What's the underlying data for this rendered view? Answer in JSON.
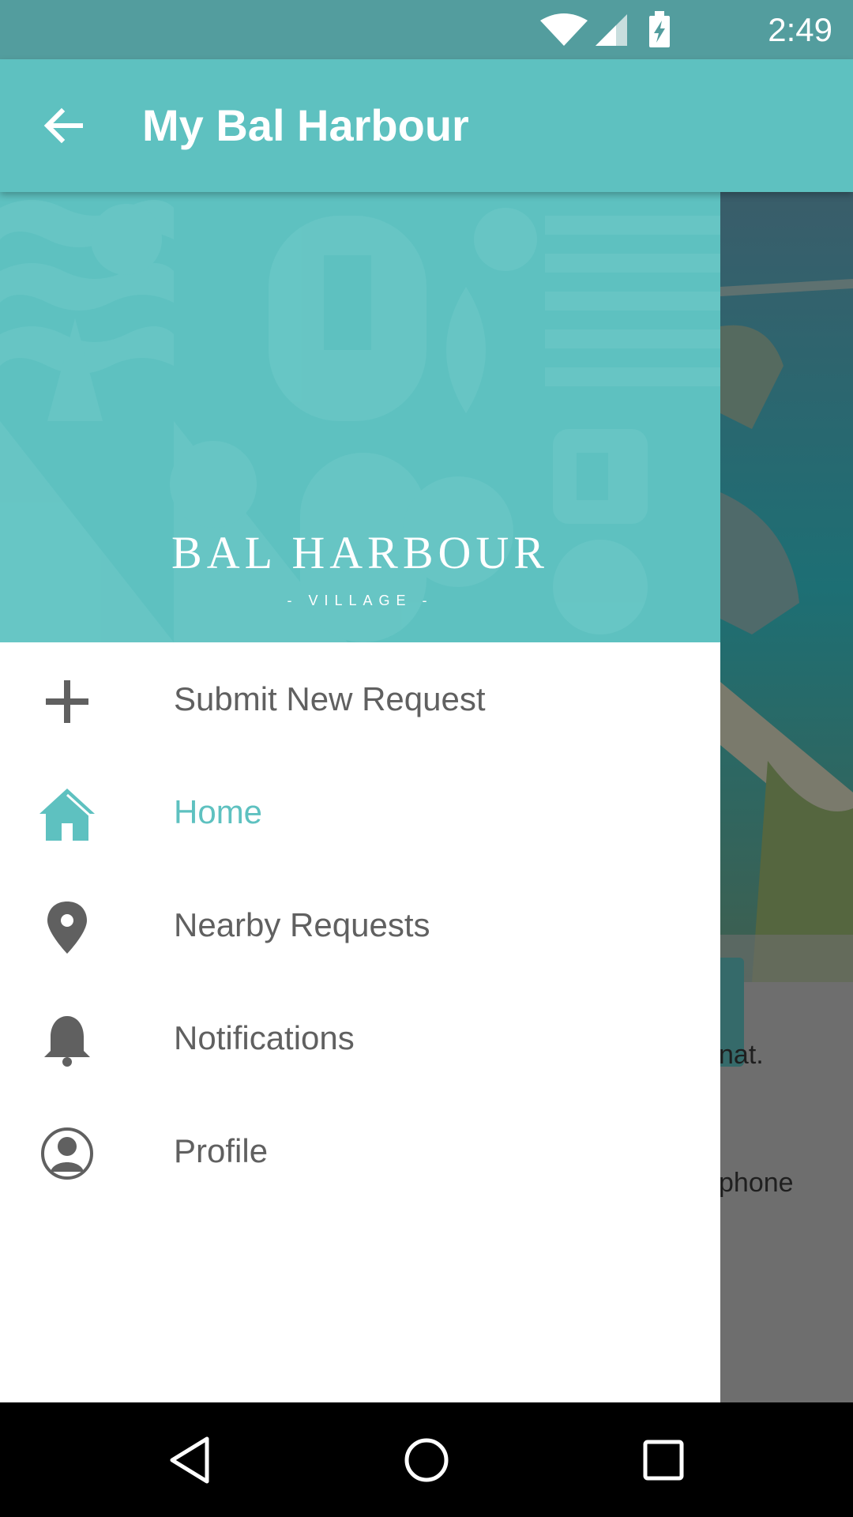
{
  "status_bar": {
    "time": "2:49",
    "icons": [
      "wifi-icon",
      "cell-signal-icon",
      "battery-charging-icon"
    ]
  },
  "app_bar": {
    "title": "My Bal Harbour",
    "back_icon": "arrow-left-icon"
  },
  "drawer": {
    "logo_main": "BAL HARBOUR",
    "logo_sub": "- VILLAGE -",
    "items": [
      {
        "label": "Submit New Request",
        "icon": "plus-icon",
        "active": false
      },
      {
        "label": "Home",
        "icon": "home-icon",
        "active": true
      },
      {
        "label": "Nearby Requests",
        "icon": "location-pin-icon",
        "active": false
      },
      {
        "label": "Notifications",
        "icon": "bell-icon",
        "active": false
      },
      {
        "label": "Profile",
        "icon": "user-circle-icon",
        "active": false
      }
    ]
  },
  "background": {
    "text_1": "nat.",
    "text_2": "phone"
  },
  "colors": {
    "accent": "#5ec1c0",
    "status_bar": "#539d9e",
    "menu_text": "#606060"
  },
  "nav_bar": {
    "buttons": [
      "back-triangle-icon",
      "home-circle-icon",
      "recents-square-icon"
    ]
  }
}
